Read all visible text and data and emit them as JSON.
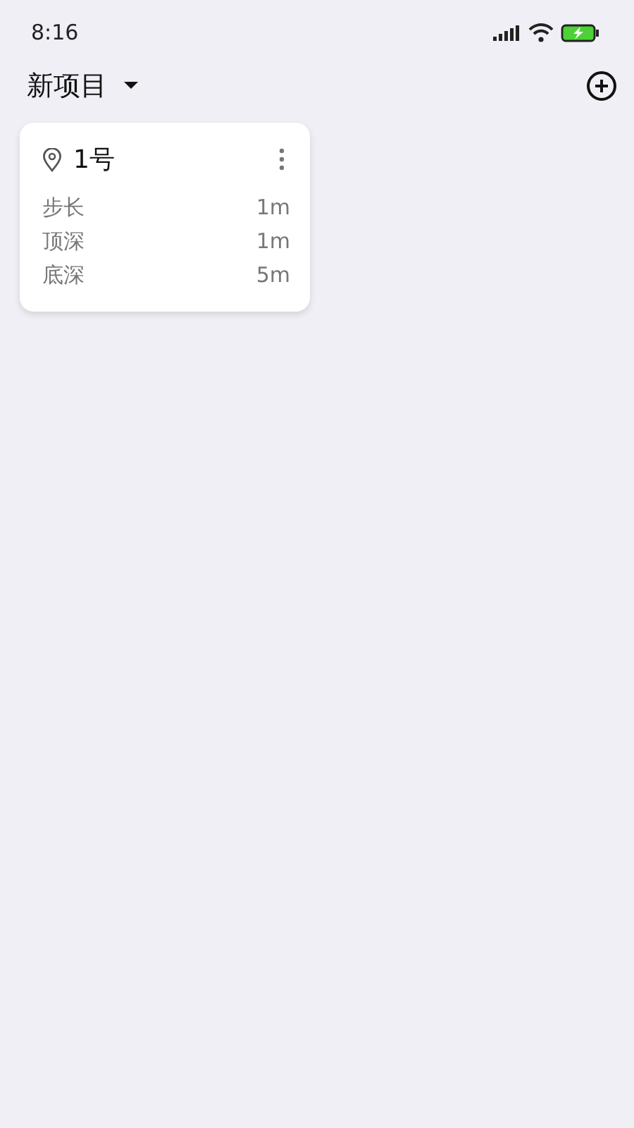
{
  "status_bar": {
    "time": "8:16"
  },
  "header": {
    "title": "新项目"
  },
  "cards": [
    {
      "title": "1号",
      "rows": [
        {
          "label": "步长",
          "value": "1m"
        },
        {
          "label": "顶深",
          "value": "1m"
        },
        {
          "label": "底深",
          "value": "5m"
        }
      ]
    }
  ]
}
